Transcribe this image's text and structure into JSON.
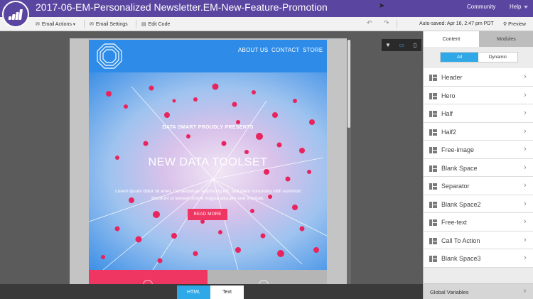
{
  "app": {
    "title": "2017-06-EM-Personalized Newsletter.EM-New-Feature-Promotion",
    "nav_community": "Community",
    "nav_help": "Help"
  },
  "toolbar": {
    "email_actions": "Email Actions",
    "email_settings": "Email Settings",
    "edit_code": "Edit Code",
    "autosaved": "Auto-saved: Apr 16, 2:47 pm PDT",
    "preview": "Preview"
  },
  "email": {
    "nav": [
      "ABOUT US",
      "CONTACT",
      "STORE"
    ],
    "kicker": "DATA SMART PROUDLY PRESENTS",
    "title": "NEW DATA TOOLSET",
    "body": "Lorem ipsum dolor sit amet, consectetuer adipiscing elit, sed diam nonummy nibh euismod tincidunt ut laoreet dolore magna aliquam erat volutpat.",
    "button": "READ MORE",
    "colors": {
      "header": "#2e8ce8",
      "accent": "#ef3561"
    }
  },
  "bottom_tabs": {
    "html": "HTML",
    "text": "Text"
  },
  "panel": {
    "tab_content": "Content",
    "tab_modules": "Modules",
    "filter_all": "All",
    "filter_dynamic": "Dynamic",
    "modules": [
      "Header",
      "Hero",
      "Half",
      "Half2",
      "Free-image",
      "Blank Space",
      "Separator",
      "Blank Space2",
      "Free-text",
      "Call To Action",
      "Blank Space3"
    ],
    "global_variables": "Global Variables"
  },
  "colors": {
    "brand": "#5a45a0",
    "active_blue": "#2ea8e6"
  }
}
